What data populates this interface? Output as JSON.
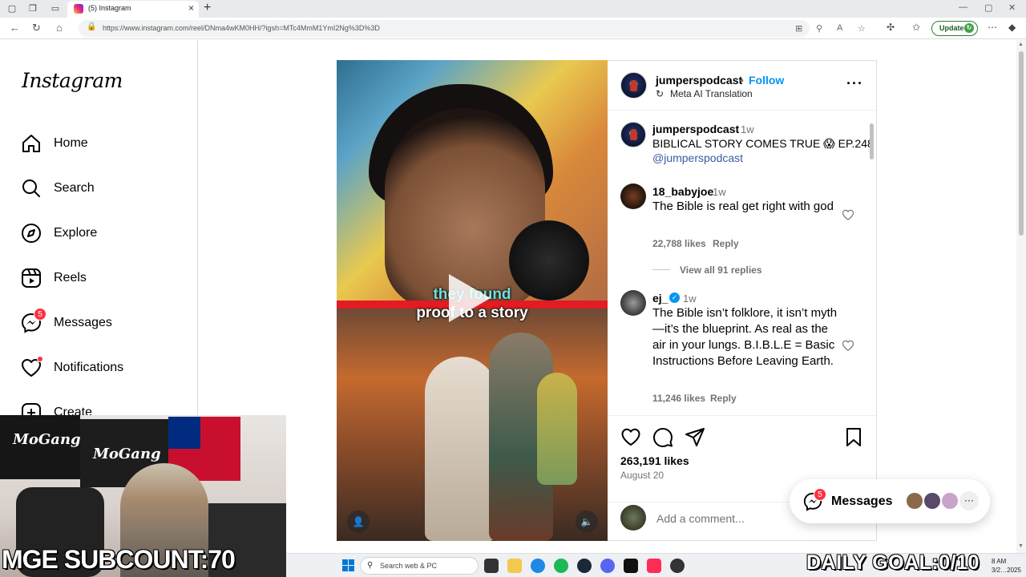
{
  "browser": {
    "tab_title": "(5) Instagram",
    "url": "https://www.instagram.com/reel/DNma4wKM0HH/?igsh=MTc4MmM1YmI2Ng%3D%3D",
    "update_label": "Update"
  },
  "sidebar": {
    "logo": "Instagram",
    "items": [
      {
        "label": "Home",
        "icon": "home-icon"
      },
      {
        "label": "Search",
        "icon": "search-icon"
      },
      {
        "label": "Explore",
        "icon": "compass-icon"
      },
      {
        "label": "Reels",
        "icon": "reels-icon"
      },
      {
        "label": "Messages",
        "icon": "messenger-icon",
        "badge": "5"
      },
      {
        "label": "Notifications",
        "icon": "heart-icon"
      },
      {
        "label": "Create",
        "icon": "plus-icon"
      }
    ]
  },
  "video": {
    "caption_line1": "they found",
    "caption_line2": "proof to a story"
  },
  "post": {
    "author": "jumperspodcast",
    "separator": "•",
    "follow_label": "Follow",
    "translation_label": "Meta AI Translation",
    "caption_author": "jumperspodcast",
    "caption_time": "1w",
    "caption_text": "BIBLICAL STORY COMES TRUE 😱 EP.248",
    "caption_mention": "@jumperspodcast",
    "comments": [
      {
        "user": "18_babyjoe",
        "time": "1w",
        "text": "The Bible is real get right with god",
        "likes": "22,788 likes",
        "reply": "Reply",
        "view_replies": "View all 91 replies"
      },
      {
        "user": "ej_",
        "time": "1w",
        "verified": true,
        "text": "The Bible isn’t folklore, it isn’t myth—it’s the blueprint. As real as the air in your lungs. B.I.B.L.E = Basic Instructions Before Leaving Earth.",
        "likes": "11,246 likes",
        "reply": "Reply"
      }
    ],
    "like_count": "263,191 likes",
    "date": "August 20",
    "add_comment_placeholder": "Add a comment..."
  },
  "messages_pill": {
    "label": "Messages",
    "badge": "5"
  },
  "stream_overlay": {
    "subcount": "MGE SUBCOUNT:",
    "subcount_value": "70",
    "daily_goal": "DAILY GOAL:0/10"
  },
  "taskbar": {
    "search_placeholder": "Search web & PC",
    "time": "8 AM",
    "date": "3/2…2025"
  }
}
